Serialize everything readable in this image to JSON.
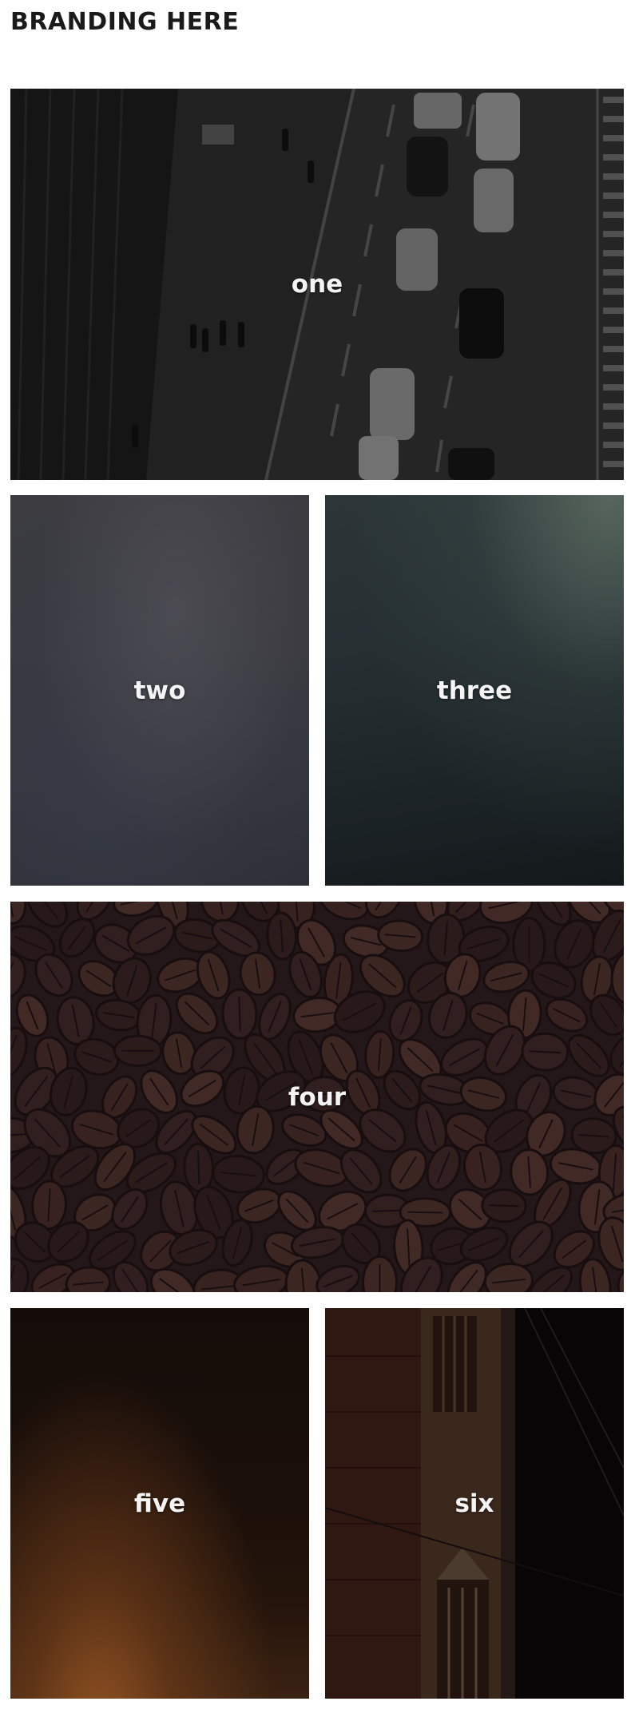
{
  "header": {
    "branding": "BRANDING HERE"
  },
  "tiles": [
    {
      "label": "one"
    },
    {
      "label": "two"
    },
    {
      "label": "three"
    },
    {
      "label": "four"
    },
    {
      "label": "five"
    },
    {
      "label": "six"
    }
  ]
}
